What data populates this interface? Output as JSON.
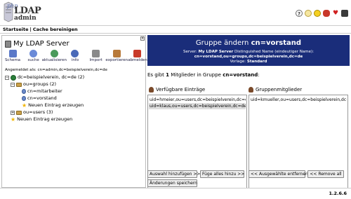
{
  "header": {
    "logo_php": "php",
    "logo_ldap": "LDAP",
    "logo_admin": "admin",
    "icons": [
      "help-icon",
      "lightbulb-icon",
      "smiley-icon",
      "bug-icon",
      "heart-icon",
      "logout-icon"
    ]
  },
  "nav": {
    "home": "Startseite",
    "sep": "|",
    "clear_cache": "Cache bereinigen"
  },
  "left": {
    "server_title": "My LDAP Server",
    "toolbar": [
      {
        "label": "Schema",
        "color": "#5a78c8"
      },
      {
        "label": "suche",
        "color": "#6a8ad8"
      },
      {
        "label": "aktualisieren",
        "color": "#4a9a5a"
      },
      {
        "label": "info",
        "color": "#4a6ab8"
      },
      {
        "label": "Import",
        "color": "#8a8a8a"
      },
      {
        "label": "exportieren",
        "color": "#b87a3a"
      },
      {
        "label": "abmelden",
        "color": "#c83a2a"
      }
    ],
    "logged_in": "Angemeldet als: cn=admin,dc=beispielverein,dc=de",
    "tree": {
      "root": "dc=beispielverein, dc=de (2)",
      "groups": "ou=groups (2)",
      "mitarbeiter": "cn=mitarbeiter",
      "vorstand": "cn=vorstand",
      "new_in_groups": "Neuen Eintrag erzeugen",
      "users": "ou=users (3)",
      "new_in_root": "Neuen Eintrag erzeugen"
    }
  },
  "right": {
    "title_prefix": "Gruppe ändern",
    "title_dn": "cn=vorstand",
    "server_label": "Server:",
    "server_name": "My LDAP Server",
    "dn_label": "Distinguished Name (eindeutiger Name):",
    "dn_value": "cn=vorstand,ou=groups,dc=beispielverein,dc=de",
    "template_label": "Vorlage:",
    "template_value": "Standard",
    "members_prefix": "Es gibt",
    "members_count": "1",
    "members_middle": "Mitglieder in Gruppe",
    "members_group": "cn=vorstand",
    "members_suffix": ":",
    "available_title": "Verfügbare Einträge",
    "available": [
      {
        "dn": "uid=hmeier,ou=users,dc=beispielverein,dc=de",
        "selected": false
      },
      {
        "dn": "uid=klaus,ou=users,dc=beispielverein,dc=de",
        "selected": true
      }
    ],
    "members_title": "Gruppenmitglieder",
    "members": [
      {
        "dn": "uid=kmueller,ou=users,dc=beispielverein,dc=de"
      }
    ],
    "buttons": {
      "add_selected": "Auswahl hinzufügen >>",
      "add_all": "Füge alles hinzu >>",
      "remove_selected": "<< Ausgewählte entfernen",
      "remove_all": "<< Remove all",
      "save": "Änderungen speichern"
    }
  },
  "footer": {
    "version": "1.2.6.6"
  }
}
